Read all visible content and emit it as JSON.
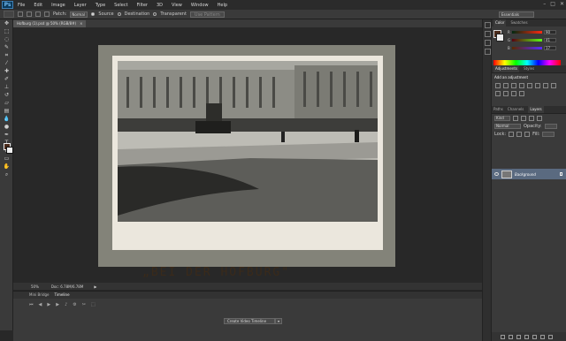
{
  "app": {
    "logo": "Ps"
  },
  "menu": [
    "File",
    "Edit",
    "Image",
    "Layer",
    "Type",
    "Select",
    "Filter",
    "3D",
    "View",
    "Window",
    "Help"
  ],
  "options_bar": {
    "patch_label": "Patch:",
    "patch_value": "Normal",
    "source_label": "Source",
    "destination_label": "Destination",
    "transparent_label": "Transparent",
    "use_pattern_label": "Use Pattern",
    "workspace": "Essentials"
  },
  "document": {
    "tab_title": "Hofburg (1).psd @ 50% (RGB/8#)",
    "caption": "„BEI DER HOFBURG\""
  },
  "status": {
    "zoom": "50%",
    "doc_size": "Doc: 6.78M/6.78M"
  },
  "timeline": {
    "tabs": [
      "Mini Bridge",
      "Timeline"
    ],
    "create_button": "Create Video Timeline"
  },
  "color_panel": {
    "tabs": [
      "Color",
      "Swatches"
    ],
    "channels": [
      {
        "label": "R",
        "value": "90"
      },
      {
        "label": "G",
        "value": "41"
      },
      {
        "label": "B",
        "value": "17"
      }
    ]
  },
  "adjustments_panel": {
    "tabs": [
      "Adjustments",
      "Styles"
    ],
    "title": "Add an adjustment"
  },
  "layers_panel": {
    "tabs": [
      "Paths",
      "Channels",
      "Layers"
    ],
    "kind_label": "Kind",
    "blend_mode": "Normal",
    "opacity_label": "Opacity:",
    "lock_label": "Lock:",
    "fill_label": "Fill:",
    "layer_name": "Background"
  }
}
